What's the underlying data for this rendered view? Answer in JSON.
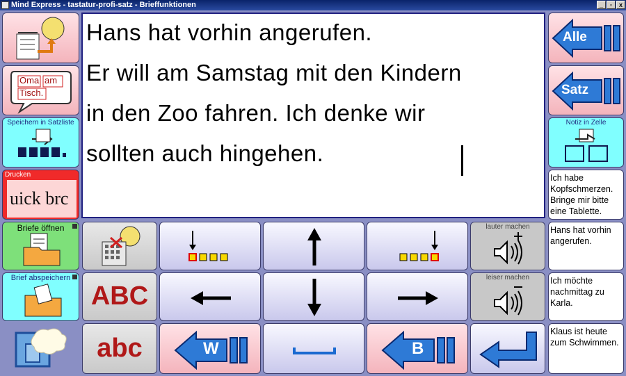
{
  "window": {
    "title": "Mind Express - tastatur-profi-satz - Brieffunktionen",
    "controls": [
      "_",
      "▫",
      "x"
    ]
  },
  "editor": {
    "lines": [
      "Hans hat vorhin angerufen.",
      "Er will am Samstag mit den Kindern",
      "in den Zoo fahren. Ich denke wir",
      "sollten auch hingehen."
    ]
  },
  "left": {
    "oma_text_1": "Oma",
    "oma_text_2": "am",
    "oma_text_3": "Tisch.",
    "save_sentence_label": "Speichern in Satzliste",
    "print_label": "Drucken",
    "print_big_text": "uick brc",
    "open_letters_label": "Briefe öffnen",
    "save_letter_label": "Brief abspeichern"
  },
  "right": {
    "all_label": "Alle",
    "sentence_label": "Satz",
    "note_cell_label": "Notiz in Zelle",
    "notes": [
      "Ich habe Kopfschmerzen. Bringe mir bitte eine Tablette.",
      "Hans hat vorhin angerufen.",
      "Ich möchte nachmittag zu Karla.",
      "Klaus ist heute zum Schwimmen."
    ]
  },
  "keys": {
    "upper": "ABC",
    "lower": "abc",
    "louder_label": "lauter machen",
    "quieter_label": "leiser machen",
    "word_back_letter": "W",
    "letter_back_letter": "B"
  }
}
